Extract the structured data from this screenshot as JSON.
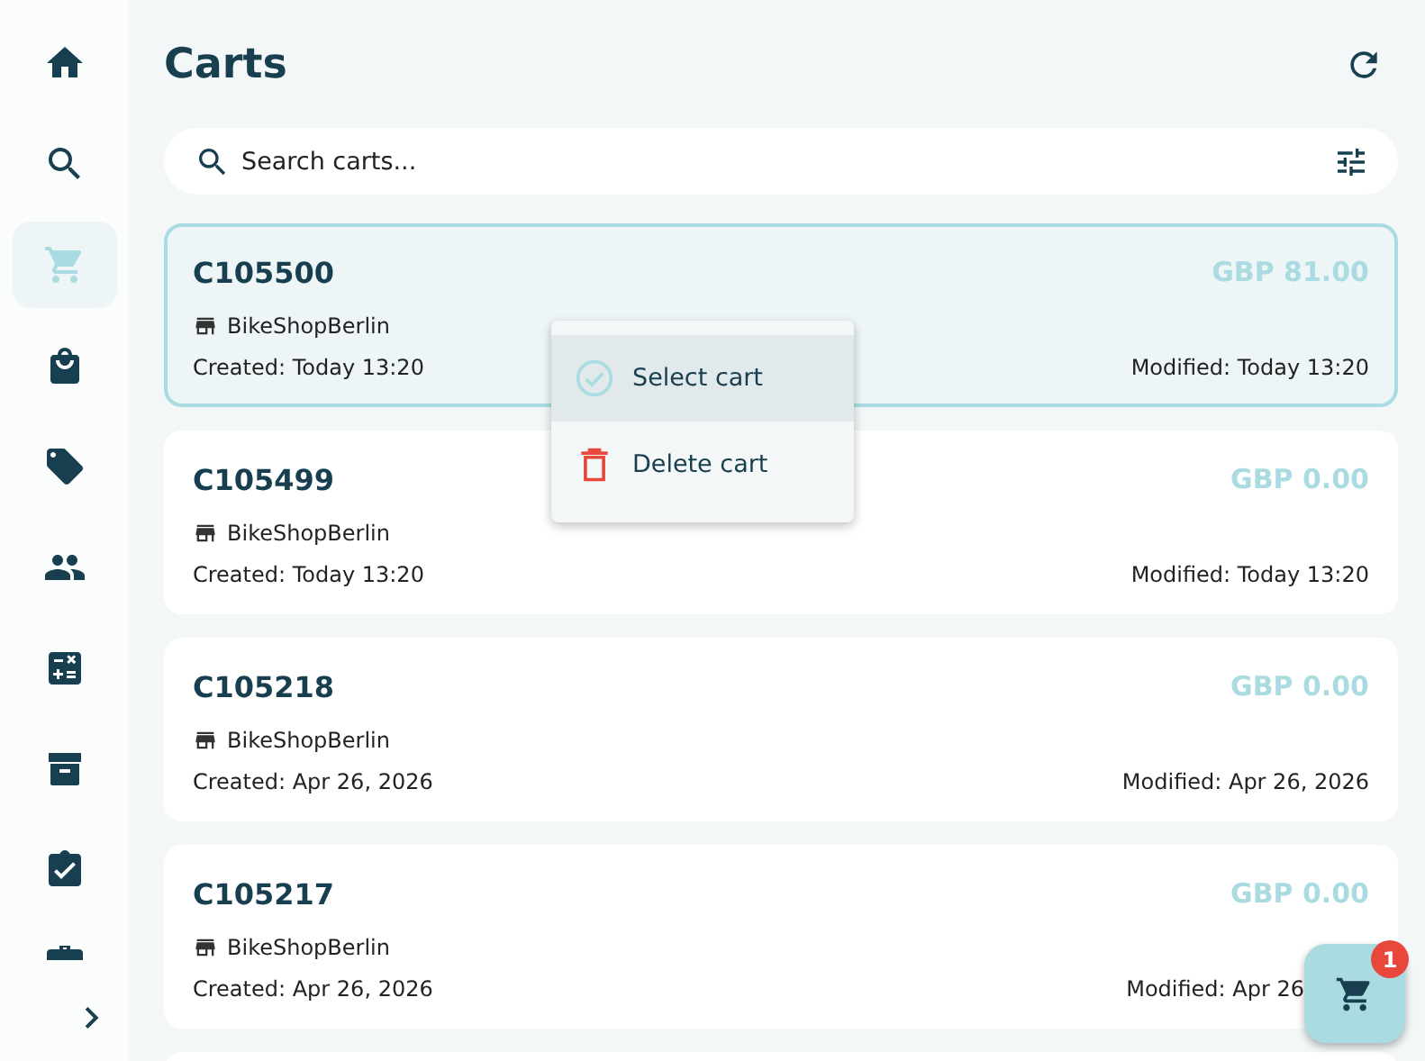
{
  "sidebar": {
    "items": [
      {
        "selected": false
      },
      {
        "selected": false
      },
      {
        "selected": true
      },
      {
        "selected": false
      },
      {
        "selected": false
      },
      {
        "selected": false
      },
      {
        "selected": false
      },
      {
        "selected": false
      },
      {
        "selected": false
      },
      {
        "selected": false
      }
    ]
  },
  "header": {
    "title": "Carts"
  },
  "search": {
    "placeholder": "Search carts..."
  },
  "carts": [
    {
      "id": "C105500",
      "shop": "BikeShopBerlin",
      "total": "GBP 81.00",
      "created": "Created: Today 13:20",
      "modified": "Modified: Today 13:20",
      "selected": true
    },
    {
      "id": "C105499",
      "shop": "BikeShopBerlin",
      "total": "GBP 0.00",
      "created": "Created: Today 13:20",
      "modified": "Modified: Today 13:20",
      "selected": false
    },
    {
      "id": "C105218",
      "shop": "BikeShopBerlin",
      "total": "GBP 0.00",
      "created": "Created: Apr 26, 2026",
      "modified": "Modified: Apr 26, 2026",
      "selected": false
    },
    {
      "id": "C105217",
      "shop": "BikeShopBerlin",
      "total": "GBP 0.00",
      "created": "Created: Apr 26, 2026",
      "modified": "Modified: Apr 26",
      "selected": false
    }
  ],
  "context_menu": {
    "items": [
      {
        "kind": "select",
        "label": "Select cart",
        "selected": true
      },
      {
        "kind": "delete",
        "label": "Delete cart",
        "selected": false
      }
    ]
  },
  "cart_fab": {
    "badge": "1"
  }
}
